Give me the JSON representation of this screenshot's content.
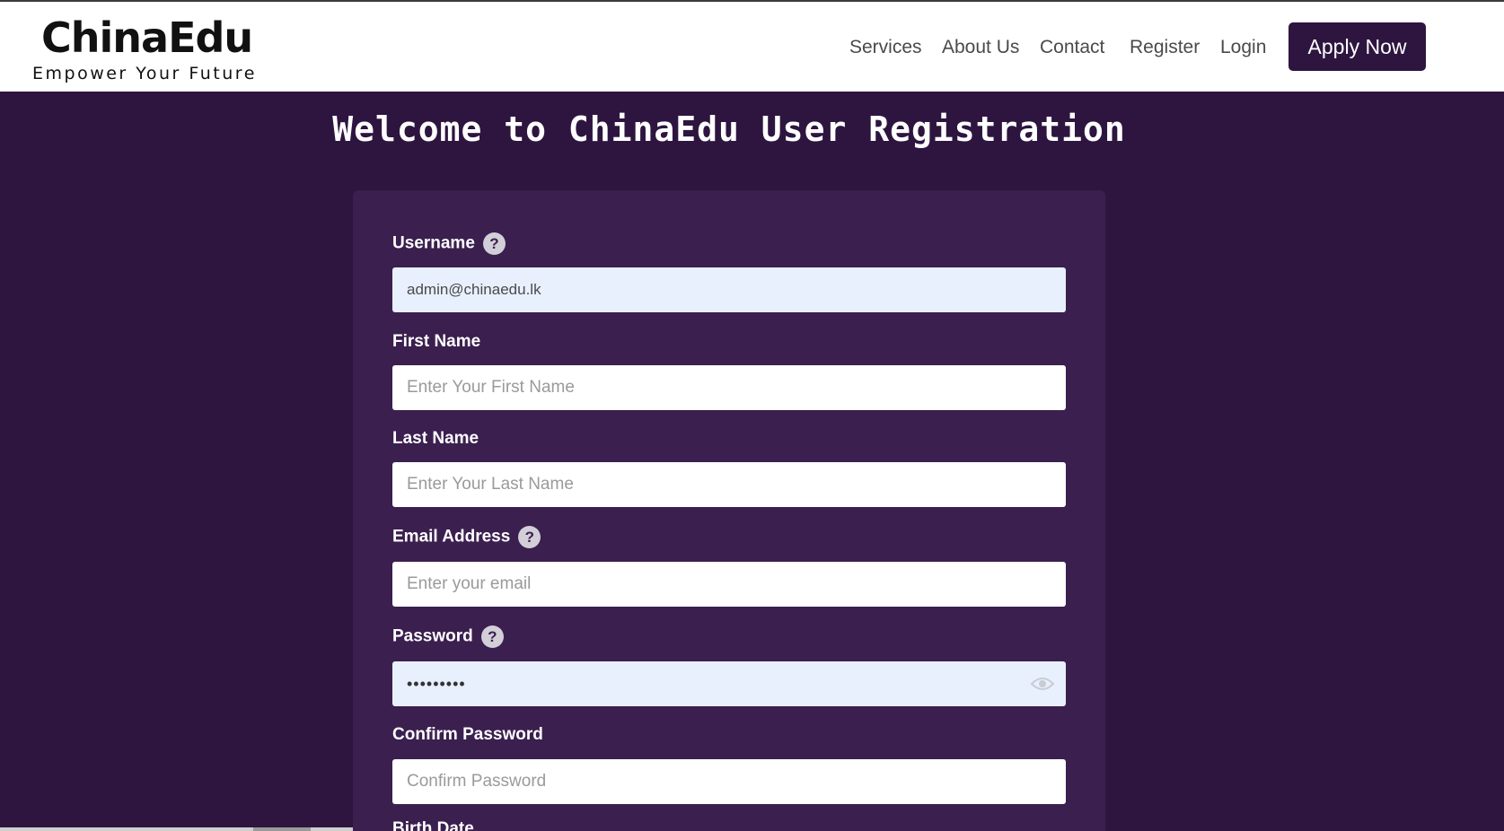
{
  "header": {
    "logo_title": "ChinaEdu",
    "logo_tagline": "Empower Your Future",
    "nav": {
      "services": "Services",
      "about": "About Us",
      "contact": "Contact",
      "register": "Register",
      "login": "Login"
    },
    "apply_label": "Apply Now"
  },
  "page_title": "Welcome to ChinaEdu User Registration",
  "form": {
    "username": {
      "label": "Username",
      "value": "admin@chinaedu.lk",
      "help_icon": "?"
    },
    "first_name": {
      "label": "First Name",
      "placeholder": "Enter Your First Name"
    },
    "last_name": {
      "label": "Last Name",
      "placeholder": "Enter Your Last Name"
    },
    "email": {
      "label": "Email Address",
      "placeholder": "Enter your email",
      "help_icon": "?"
    },
    "password": {
      "label": "Password",
      "value": "•••••••••",
      "help_icon": "?",
      "toggle_icon": "eye-icon"
    },
    "confirm_password": {
      "label": "Confirm Password",
      "placeholder": "Confirm Password"
    },
    "next_label_partial": "Birth Date"
  },
  "colors": {
    "background": "#2e1540",
    "card": "#3b1f4f",
    "autofill_field": "#e8f0fe",
    "apply_button": "#2e1540"
  }
}
